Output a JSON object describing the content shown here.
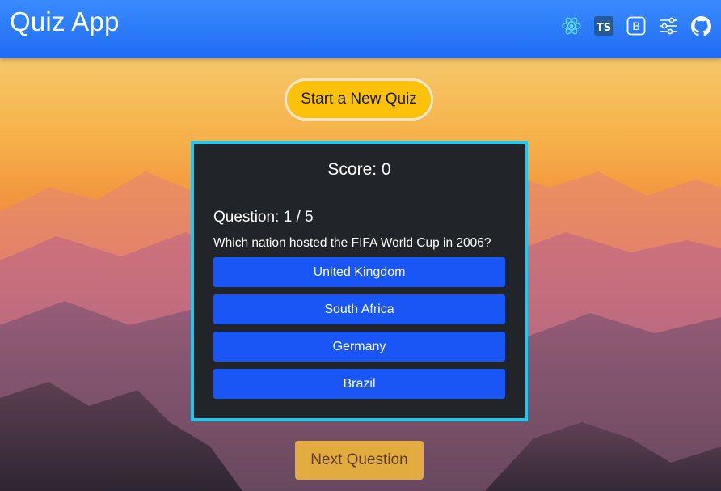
{
  "header": {
    "title": "Quiz App",
    "icons": [
      "react-icon",
      "typescript-icon",
      "bootstrap-icon",
      "settings-sliders-icon",
      "github-icon"
    ],
    "ts_label": "TS",
    "bootstrap_label": "B"
  },
  "main": {
    "start_button": "Start a New Quiz",
    "score_label": "Score: 0",
    "question_number": "Question: 1 / 5",
    "question_text": "Which nation hosted the FIFA World Cup in 2006?",
    "answers": [
      "United Kingdom",
      "South Africa",
      "Germany",
      "Brazil"
    ],
    "next_button": "Next Question"
  },
  "colors": {
    "header": "#2b7bfa",
    "start_button": "#fcc10a",
    "card_bg": "#212529",
    "card_border": "#1ec8ee",
    "answer_button": "#1a56f5",
    "next_button": "#e9b13f"
  }
}
